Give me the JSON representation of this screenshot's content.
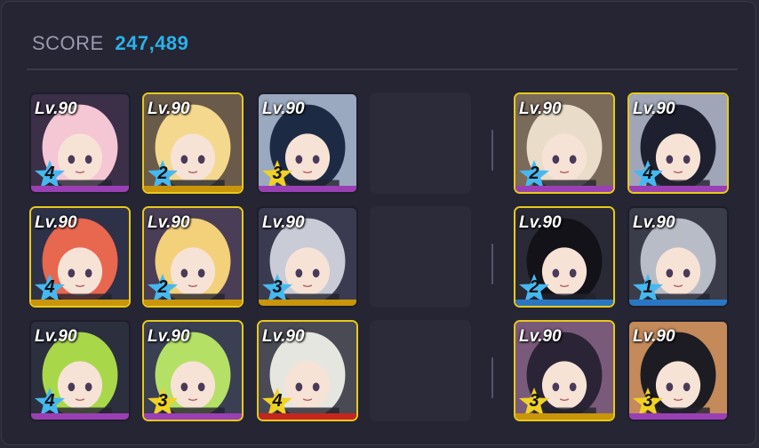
{
  "score": {
    "label": "SCORE",
    "value": "247,489"
  },
  "colors": {
    "accent": "#2bb2e8",
    "gold_border": "#e8c91a",
    "bar_purple": "#9b3fb5",
    "bar_gold": "#c9950a",
    "bar_blue": "#2b76c2",
    "bar_red": "#c4261e",
    "star_blue": "#46b8f0",
    "star_yellow": "#f0d224"
  },
  "team_left": [
    {
      "level": "Lv.90",
      "stars": "4",
      "star_color": "blue",
      "bar": "purple",
      "border": "plain",
      "hair": "#f5c6d4",
      "bg": "#3b3048"
    },
    {
      "level": "Lv.90",
      "stars": "2",
      "star_color": "blue",
      "bar": "gold",
      "border": "gold",
      "hair": "#f3d88e",
      "bg": "#6a5a4a"
    },
    {
      "level": "Lv.90",
      "stars": "3",
      "star_color": "yellow",
      "bar": "purple",
      "border": "plain",
      "hair": "#1d2a44",
      "bg": "#9aa8c0"
    },
    {
      "level": "Lv.90",
      "stars": "4",
      "star_color": "blue",
      "bar": "gold",
      "border": "gold",
      "hair": "#e8674f",
      "bg": "#2e3248"
    },
    {
      "level": "Lv.90",
      "stars": "2",
      "star_color": "blue",
      "bar": "gold",
      "border": "gold",
      "hair": "#f3d07a",
      "bg": "#4a3e56"
    },
    {
      "level": "Lv.90",
      "stars": "3",
      "star_color": "blue",
      "bar": "gold",
      "border": "plain",
      "hair": "#c9ccd6",
      "bg": "#3a3a50"
    },
    {
      "level": "Lv.90",
      "stars": "4",
      "star_color": "blue",
      "bar": "purple",
      "border": "plain",
      "hair": "#a8d84a",
      "bg": "#2c2f3e"
    },
    {
      "level": "Lv.90",
      "stars": "3",
      "star_color": "yellow",
      "bar": "purple",
      "border": "gold",
      "hair": "#b4e066",
      "bg": "#3a3f52"
    },
    {
      "level": "Lv.90",
      "stars": "4",
      "star_color": "yellow",
      "bar": "red",
      "border": "gold",
      "hair": "#e6e6e0",
      "bg": "#4a4a54"
    }
  ],
  "team_right": [
    {
      "level": "Lv.90",
      "stars": "2",
      "star_color": "blue",
      "bar": "purple",
      "border": "gold",
      "hair": "#e9ddc9",
      "bg": "#7a6a5a"
    },
    {
      "level": "Lv.90",
      "stars": "4",
      "star_color": "blue",
      "bar": "purple",
      "border": "gold",
      "hair": "#1e2030",
      "bg": "#a0a6b8"
    },
    {
      "level": "Lv.90",
      "stars": "2",
      "star_color": "blue",
      "bar": "blue",
      "border": "gold",
      "hair": "#121218",
      "bg": "#2a2a36"
    },
    {
      "level": "Lv.90",
      "stars": "1",
      "star_color": "blue",
      "bar": "blue",
      "border": "plain",
      "hair": "#b8bcc6",
      "bg": "#3a3c4a"
    },
    {
      "level": "Lv.90",
      "stars": "3",
      "star_color": "yellow",
      "bar": "gold",
      "border": "gold",
      "hair": "#2a2436",
      "bg": "#7a5a7a"
    },
    {
      "level": "Lv.90",
      "stars": "3",
      "star_color": "yellow",
      "bar": "purple",
      "border": "plain",
      "hair": "#1c1c22",
      "bg": "#c48a5a"
    }
  ]
}
